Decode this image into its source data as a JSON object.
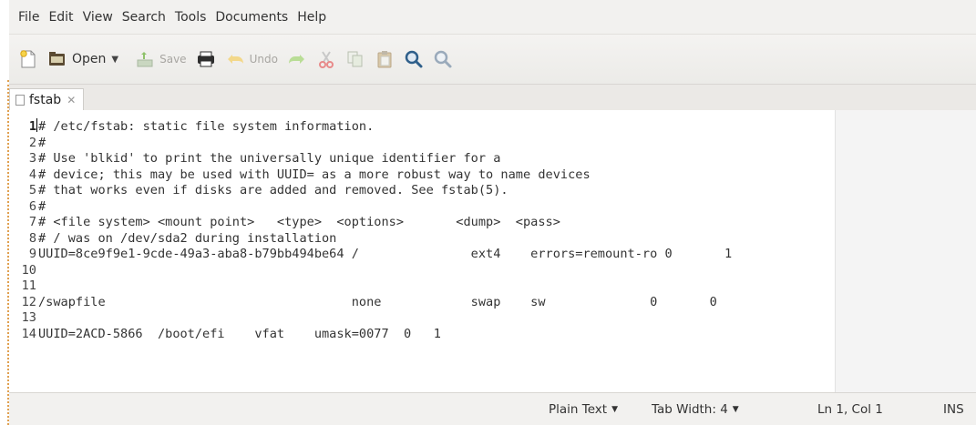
{
  "menu": [
    "File",
    "Edit",
    "View",
    "Search",
    "Tools",
    "Documents",
    "Help"
  ],
  "toolbar": {
    "open_label": "Open",
    "save_label": "Save",
    "undo_label": "Undo",
    "icons": [
      "new-document-icon",
      "open-folder-icon",
      "save-icon",
      "print-icon",
      "undo-icon",
      "redo-icon",
      "cut-icon",
      "copy-icon",
      "paste-icon",
      "search-icon",
      "search-replace-icon"
    ]
  },
  "tab": {
    "name": "fstab",
    "close": "✕"
  },
  "editor": {
    "current_line": 1,
    "lines": [
      "# /etc/fstab: static file system information.",
      "#",
      "# Use 'blkid' to print the universally unique identifier for a",
      "# device; this may be used with UUID= as a more robust way to name devices",
      "# that works even if disks are added and removed. See fstab(5).",
      "#",
      "# <file system> <mount point>   <type>  <options>       <dump>  <pass>",
      "# / was on /dev/sda2 during installation",
      "UUID=8ce9f9e1-9cde-49a3-aba8-b79bb494be64 /               ext4    errors=remount-ro 0       1",
      "",
      "",
      "/swapfile                                 none            swap    sw              0       0",
      "",
      "UUID=2ACD-5866  /boot/efi    vfat    umask=0077  0   1"
    ]
  },
  "status": {
    "language": "Plain Text",
    "tab_width": "Tab Width: 4",
    "position": "Ln 1, Col 1",
    "mode": "INS"
  }
}
